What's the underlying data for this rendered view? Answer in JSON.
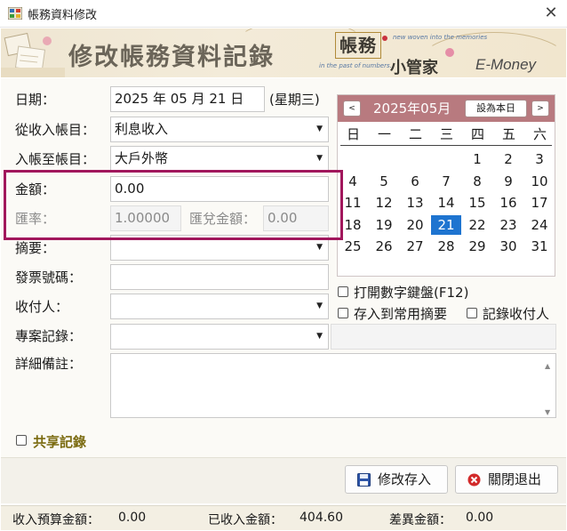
{
  "window": {
    "title": "帳務資料修改",
    "close_glyph": "✕"
  },
  "banner": {
    "title": "修改帳務資料記錄",
    "logo_text": "帳務",
    "subtitle": "小管家",
    "brand": "E-Money",
    "tag_top": "new woven into the memories",
    "tag_bottom": "in the past of numbers."
  },
  "form": {
    "date": {
      "label": "日期：",
      "value": "2025 年 05 月 21 日",
      "weekday": "(星期三)"
    },
    "from_account": {
      "label": "從收入帳目：",
      "value": "利息收入"
    },
    "to_account": {
      "label": "入帳至帳目：",
      "value": "大戶外幣"
    },
    "amount": {
      "label": "金額：",
      "value": "0.00"
    },
    "exchange_rate": {
      "label": "匯率：",
      "value": "1.00000"
    },
    "exchange_amount": {
      "label": "匯兌金額：",
      "value": "0.00"
    },
    "summary": {
      "label": "摘要：",
      "value": ""
    },
    "invoice_no": {
      "label": "發票號碼：",
      "value": ""
    },
    "payee": {
      "label": "收付人：",
      "value": ""
    },
    "project": {
      "label": "專案記錄：",
      "value": ""
    },
    "notes": {
      "label": "詳細備註：",
      "value": ""
    },
    "shared": {
      "label": "共享記錄",
      "checked": false
    }
  },
  "calendar": {
    "month_label": "2025年05月",
    "prev": "<",
    "next": ">",
    "today_button": "設為本日",
    "weekdays": [
      "日",
      "一",
      "二",
      "三",
      "四",
      "五",
      "六"
    ],
    "weeks": [
      [
        "",
        "",
        "",
        "",
        "1",
        "2",
        "3"
      ],
      [
        "4",
        "5",
        "6",
        "7",
        "8",
        "9",
        "10"
      ],
      [
        "11",
        "12",
        "13",
        "14",
        "15",
        "16",
        "17"
      ],
      [
        "18",
        "19",
        "20",
        "21",
        "22",
        "23",
        "24"
      ],
      [
        "25",
        "26",
        "27",
        "28",
        "29",
        "30",
        "31"
      ]
    ],
    "selected_day": "21"
  },
  "options": {
    "numeric_keypad": {
      "label": "打開數字鍵盤(F12)",
      "checked": false
    },
    "save_common_summary": {
      "label": "存入到常用摘要",
      "checked": false
    },
    "record_payee": {
      "label": "記錄收付人",
      "checked": false
    }
  },
  "buttons": {
    "save": "修改存入",
    "close": "關閉退出"
  },
  "status": {
    "income_budget_label": "收入預算金額：",
    "income_budget_value": "0.00",
    "received_label": "已收入金額：",
    "received_value": "404.60",
    "difference_label": "差異金額：",
    "difference_value": "0.00"
  },
  "colors": {
    "calendar_header": "#b87a7f",
    "selected_day": "#1e74d0",
    "annotation": "#a1175c",
    "shared_label": "#7a6a0f"
  }
}
